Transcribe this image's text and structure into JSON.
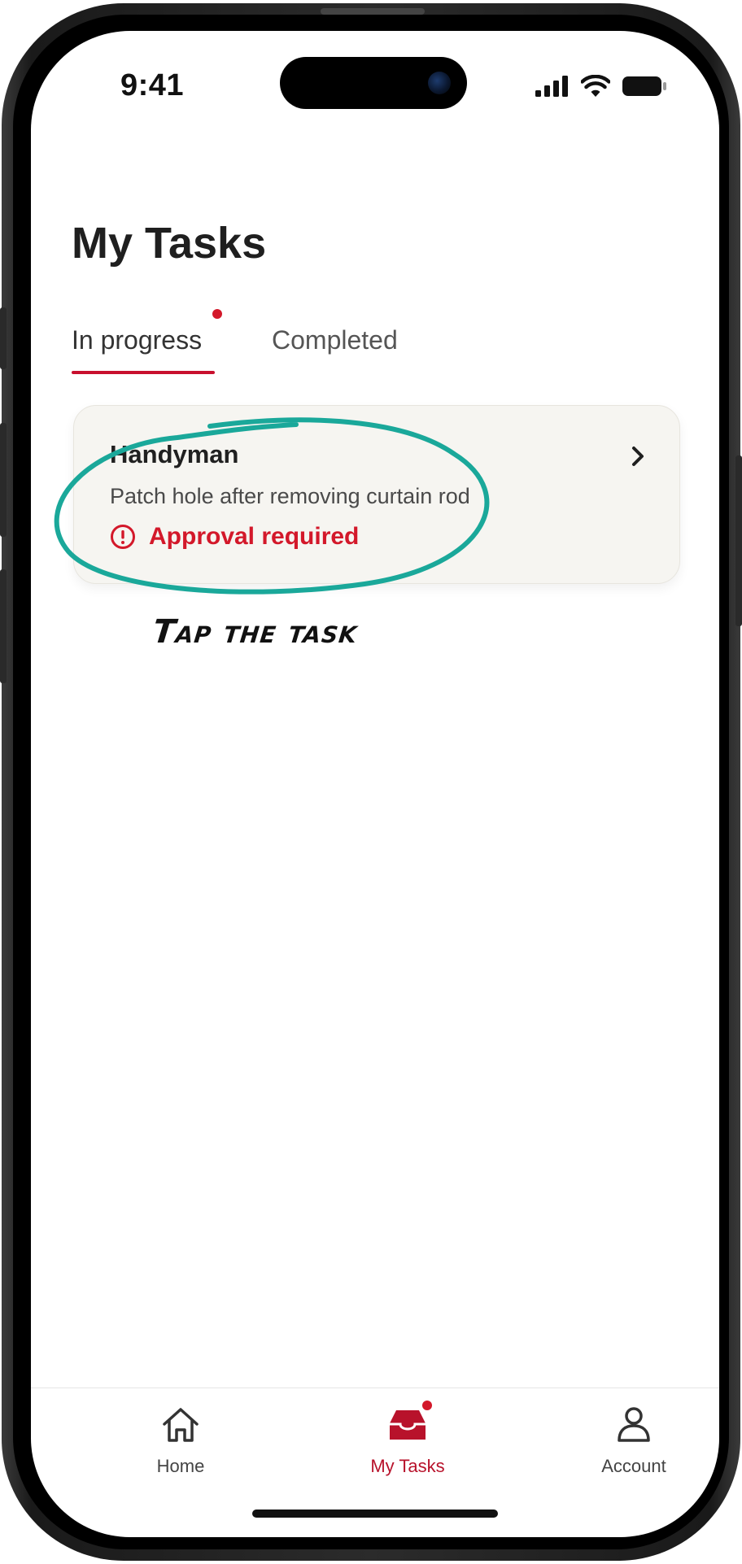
{
  "status_bar": {
    "time": "9:41"
  },
  "header": {
    "title": "My Tasks"
  },
  "tabs": [
    {
      "label": "In progress",
      "active": true,
      "has_notification": true
    },
    {
      "label": "Completed",
      "active": false,
      "has_notification": false
    }
  ],
  "task": {
    "title": "Handyman",
    "description": "Patch hole after removing curtain rod",
    "status": "Approval required",
    "status_icon": "alert-circle-icon",
    "chevron_icon": "chevron-right-icon"
  },
  "annotation": {
    "text": "Tap the task",
    "color": "#1aa89a"
  },
  "bottom_nav": {
    "items": [
      {
        "label": "Home",
        "icon": "home-icon",
        "active": false
      },
      {
        "label": "My Tasks",
        "icon": "inbox-icon",
        "active": true,
        "has_notification": true
      },
      {
        "label": "Account",
        "icon": "person-icon",
        "active": false
      }
    ]
  },
  "colors": {
    "accent": "#c8102e",
    "alert": "#d3182a",
    "card_bg": "#f6f5f1"
  }
}
